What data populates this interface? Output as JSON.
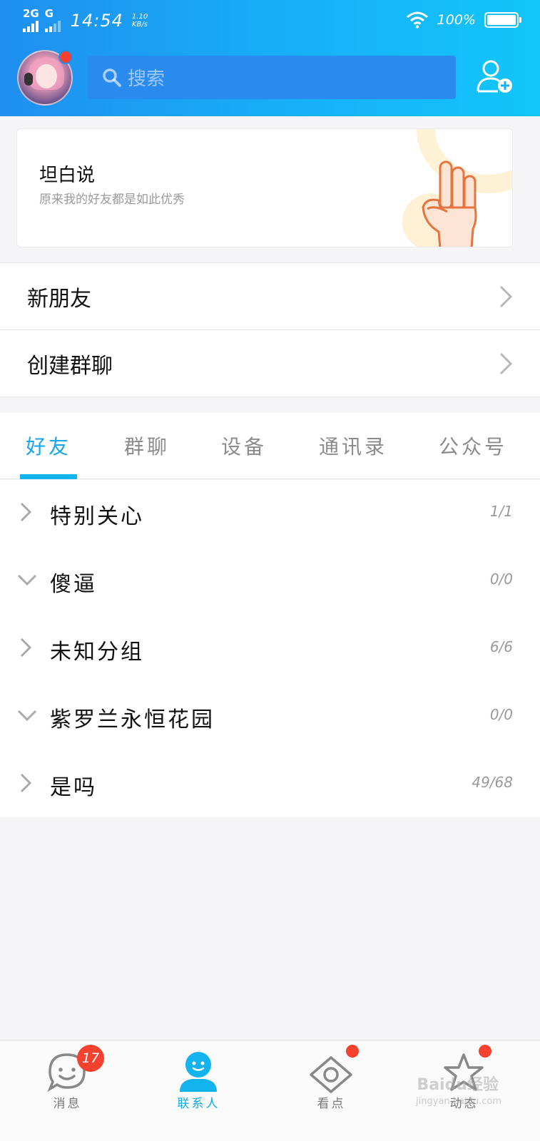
{
  "status_bar": {
    "net1": "2G",
    "net2": "G",
    "time": "14:54",
    "speed_value": "1.10",
    "speed_unit": "KB/s",
    "battery": "100%"
  },
  "header": {
    "search_placeholder": "搜索"
  },
  "banner": {
    "title": "坦白说",
    "subtitle": "原来我的好友都是如此优秀"
  },
  "rows": {
    "new_friends": "新朋友",
    "create_group": "创建群聊"
  },
  "tabs": [
    "好友",
    "群聊",
    "设备",
    "通讯录",
    "公众号"
  ],
  "groups": [
    {
      "name": "特别关心",
      "count": "1/1",
      "expanded": false
    },
    {
      "name": "傻逼",
      "count": "0/0",
      "expanded": true
    },
    {
      "name": "未知分组",
      "count": "6/6",
      "expanded": false
    },
    {
      "name": "紫罗兰永恒花园",
      "count": "0/0",
      "expanded": true
    },
    {
      "name": "是吗",
      "count": "49/68",
      "expanded": false
    }
  ],
  "tabbar": {
    "messages": "消息",
    "messages_badge": "17",
    "contacts": "联系人",
    "watch": "看点",
    "moments": "动态"
  },
  "watermark": {
    "brand": "Baidu经验",
    "url": "jingyan.baidu.com"
  },
  "colors": {
    "accent": "#12b3ee",
    "badge": "#f5412e"
  }
}
